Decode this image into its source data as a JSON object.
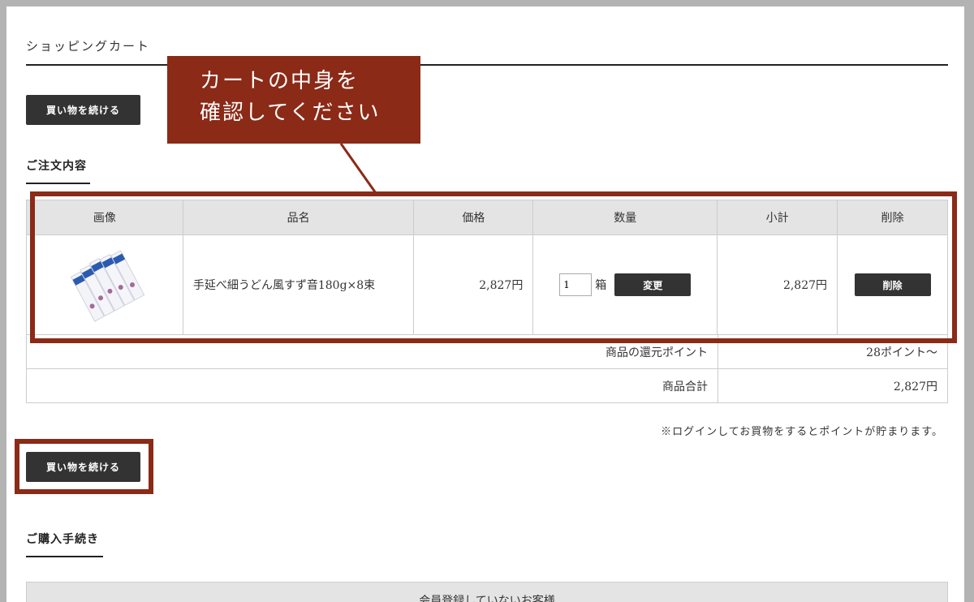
{
  "page": {
    "title": "ショッピングカート",
    "continue_label": "買い物を続ける"
  },
  "order": {
    "title": "ご注文内容",
    "headers": {
      "image": "画像",
      "name": "品名",
      "price": "価格",
      "qty": "数量",
      "subtotal": "小計",
      "delete": "削除"
    },
    "item": {
      "name": "手延べ細うどん風すず音180g×8束",
      "price": "2,827円",
      "qty": "1",
      "unit": "箱",
      "change_label": "変更",
      "subtotal": "2,827円",
      "delete_label": "削除"
    },
    "points_label": "商品の還元ポイント",
    "points_value": "28ポイント～",
    "total_label": "商品合計",
    "total_value": "2,827円"
  },
  "note": "※ログインしてお買物をするとポイントが貯まります。",
  "procedure": {
    "title": "ご購入手続き",
    "member_label": "会員登録していないお客様"
  },
  "annotation": {
    "line1": "カートの中身を",
    "line2": "確認してください"
  },
  "colors": {
    "accent": "#8b2a17",
    "button": "#333333",
    "header_bg": "#e4e4e4"
  }
}
